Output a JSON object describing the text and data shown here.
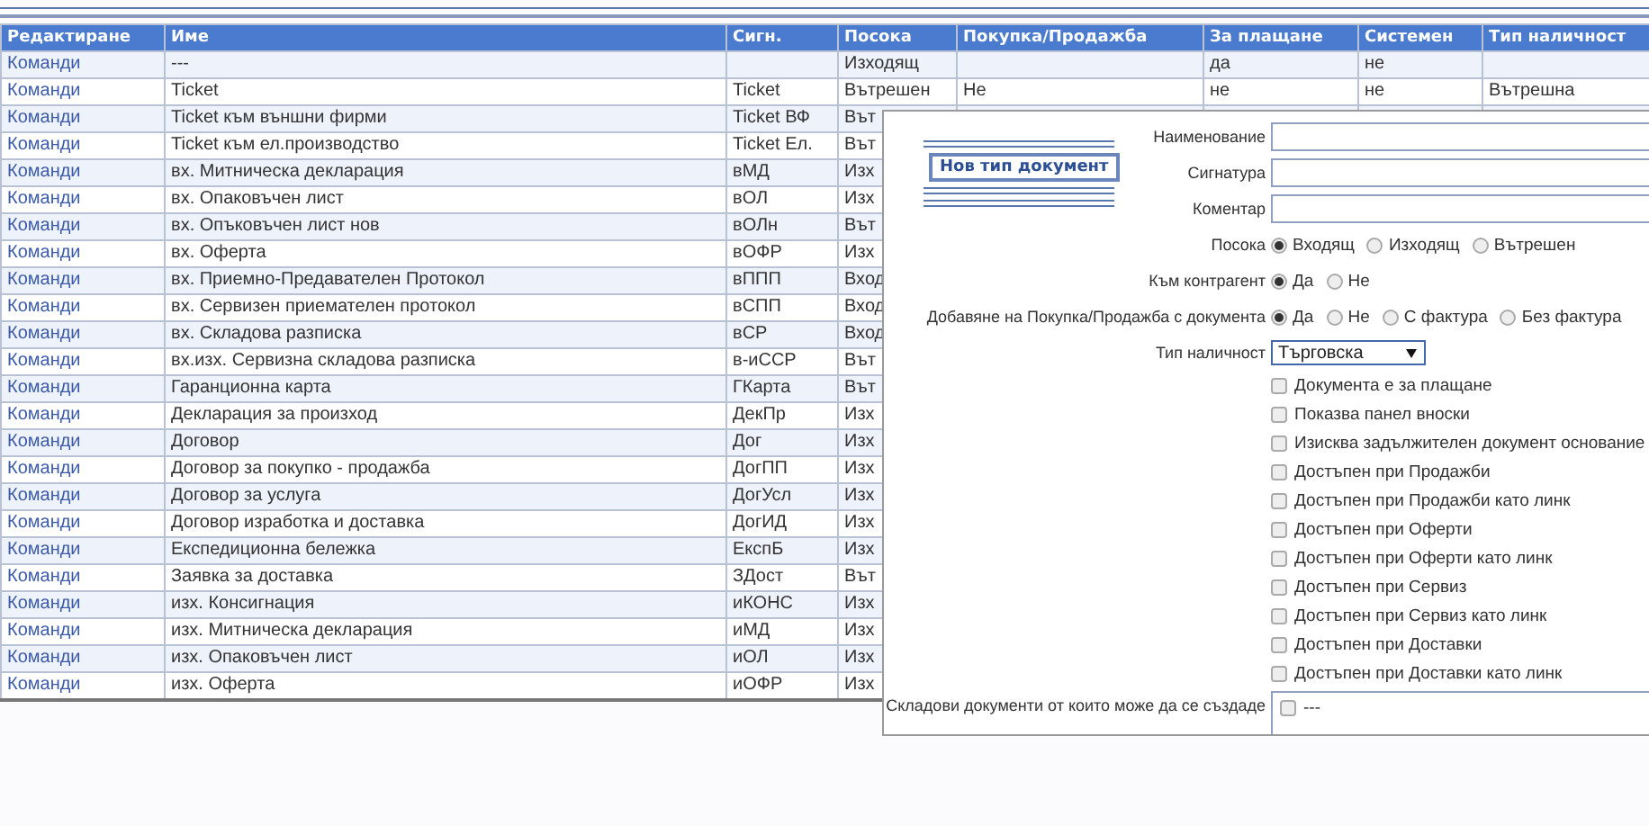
{
  "table": {
    "columns": [
      "Редактиране",
      "Име",
      "Сигн.",
      "Посока",
      "Покупка/Продажба",
      "За плащане",
      "Системен",
      "Тип наличност"
    ],
    "rows": [
      {
        "cells": [
          "Команди",
          "---",
          "",
          "Изходящ",
          "",
          "да",
          "не",
          ""
        ]
      },
      {
        "cells": [
          "Команди",
          "Ticket",
          "Ticket",
          "Вътрешен",
          "Не",
          "не",
          "не",
          "Вътрешна"
        ]
      },
      {
        "cells": [
          "Команди",
          "Ticket към външни фирми",
          "Ticket ВФ",
          "Вът"
        ]
      },
      {
        "cells": [
          "Команди",
          "Ticket към ел.производство",
          "Ticket Ел.",
          "Вът"
        ]
      },
      {
        "cells": [
          "Команди",
          "вх. Митническа декларация",
          "вМД",
          "Изх"
        ]
      },
      {
        "cells": [
          "Команди",
          "вх. Опаковъчен лист",
          "вОЛ",
          "Изх"
        ]
      },
      {
        "cells": [
          "Команди",
          "вх. Опъковъчен лист нов",
          "вОЛн",
          "Вът"
        ]
      },
      {
        "cells": [
          "Команди",
          "вх. Оферта",
          "вОФР",
          "Изх"
        ]
      },
      {
        "cells": [
          "Команди",
          "вх. Приемно-Предавателен Протокол",
          "вППП",
          "Вход"
        ]
      },
      {
        "cells": [
          "Команди",
          "вх. Сервизен приемателен протокол",
          "вСПП",
          "Вход"
        ]
      },
      {
        "cells": [
          "Команди",
          "вх. Складова разписка",
          "вСР",
          "Вход"
        ]
      },
      {
        "cells": [
          "Команди",
          "вх.изх. Сервизна складова разписка",
          "в-иССР",
          "Вът"
        ]
      },
      {
        "cells": [
          "Команди",
          "Гаранционна карта",
          "ГКарта",
          "Вът"
        ]
      },
      {
        "cells": [
          "Команди",
          "Декларация за произход",
          "ДекПр",
          "Изх"
        ]
      },
      {
        "cells": [
          "Команди",
          "Договор",
          "Дог",
          "Изх"
        ]
      },
      {
        "cells": [
          "Команди",
          "Договор за покупко - продажба",
          "ДогПП",
          "Изх"
        ]
      },
      {
        "cells": [
          "Команди",
          "Договор за услуга",
          "ДогУсл",
          "Изх"
        ]
      },
      {
        "cells": [
          "Команди",
          "Договор изработка и доставка",
          "ДогИД",
          "Изх"
        ]
      },
      {
        "cells": [
          "Команди",
          "Експедиционна бележка",
          "ЕкспБ",
          "Изх"
        ]
      },
      {
        "cells": [
          "Команди",
          "Заявка за доставка",
          "ЗДост",
          "Вът"
        ]
      },
      {
        "cells": [
          "Команди",
          "изх. Консигнация",
          "иКОНС",
          "Изх"
        ]
      },
      {
        "cells": [
          "Команди",
          "изх. Митническа декларация",
          "иМД",
          "Изх"
        ]
      },
      {
        "cells": [
          "Команди",
          "изх. Опаковъчен лист",
          "иОЛ",
          "Изх"
        ]
      },
      {
        "cells": [
          "Команди",
          "изх. Оферта",
          "иОФР",
          "Изх"
        ]
      }
    ]
  },
  "dialog": {
    "title": "Нов тип документ",
    "fields": [
      {
        "kind": "text",
        "label": "Наименование"
      },
      {
        "kind": "text",
        "label": "Сигнатура"
      },
      {
        "kind": "text",
        "label": "Коментар"
      },
      {
        "kind": "radio",
        "label": "Посока",
        "options": [
          {
            "label": "Входящ",
            "selected": true
          },
          {
            "label": "Изходящ",
            "selected": false
          },
          {
            "label": "Вътрешен",
            "selected": false
          }
        ]
      },
      {
        "kind": "radio",
        "label": "Към контрагент",
        "options": [
          {
            "label": "Да",
            "selected": true
          },
          {
            "label": "Не",
            "selected": false
          }
        ]
      },
      {
        "kind": "radio",
        "label": "Добавяне на Покупка/Продажба с документа",
        "options": [
          {
            "label": "Да",
            "selected": true
          },
          {
            "label": "Не",
            "selected": false
          },
          {
            "label": "С фактура",
            "selected": false
          },
          {
            "label": "Без фактура",
            "selected": false
          }
        ]
      },
      {
        "kind": "select",
        "label": "Тип наличност",
        "value": "Търговска"
      }
    ],
    "checkboxes": [
      {
        "label": "Документа е за плащане",
        "checked": false
      },
      {
        "label": "Показва панел вноски",
        "checked": false
      },
      {
        "label": "Изисква задължителен документ основание",
        "checked": false
      },
      {
        "label": "Достъпен при Продажби",
        "checked": false
      },
      {
        "label": "Достъпен при Продажби като линк",
        "checked": false
      },
      {
        "label": "Достъпен при Оферти",
        "checked": false
      },
      {
        "label": "Достъпен при Оферти като линк",
        "checked": false
      },
      {
        "label": "Достъпен при Сервиз",
        "checked": false
      },
      {
        "label": "Достъпен при Сервиз като линк",
        "checked": false
      },
      {
        "label": "Достъпен при Доставки",
        "checked": false
      },
      {
        "label": "Достъпен при Доставки като линк",
        "checked": false
      }
    ],
    "source_documents": {
      "label": "Складови документи от които може да се създаде",
      "items": [
        {
          "label": "---",
          "checked": false
        }
      ]
    }
  }
}
